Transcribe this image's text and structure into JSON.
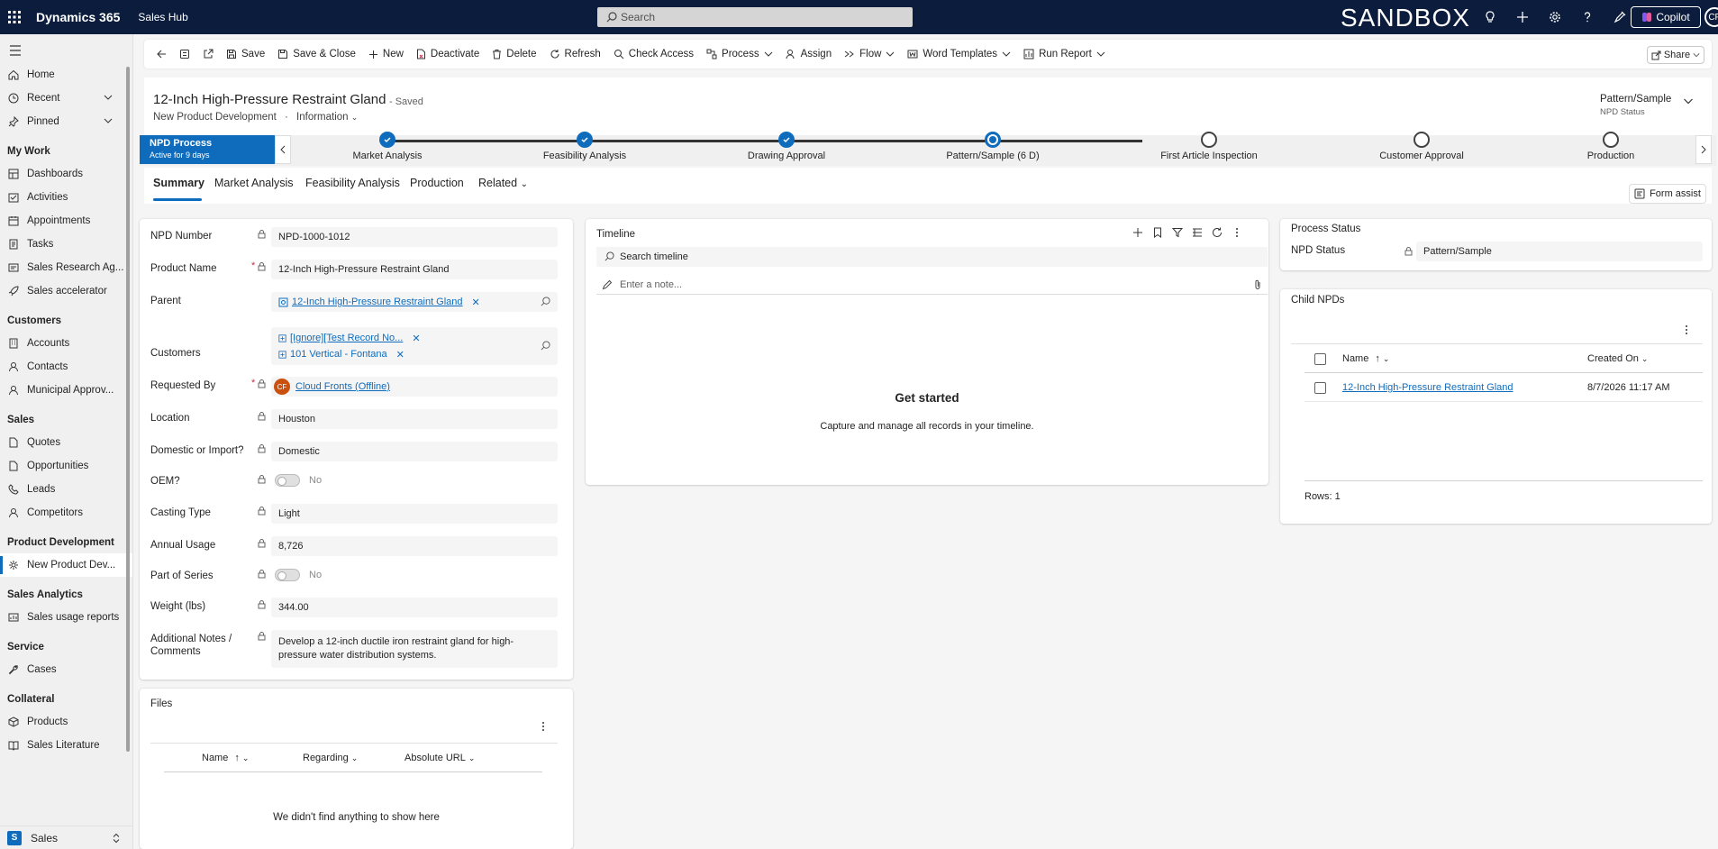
{
  "topbar": {
    "brand": "Dynamics 365",
    "app_name": "Sales Hub",
    "search_placeholder": "Search",
    "environment": "SANDBOX",
    "copilot_label": "Copilot",
    "avatar_initials": "CF"
  },
  "sidebar": {
    "top": [
      {
        "label": "Home"
      },
      {
        "label": "Recent"
      },
      {
        "label": "Pinned"
      }
    ],
    "sections": [
      {
        "title": "My Work",
        "items": [
          "Dashboards",
          "Activities",
          "Appointments",
          "Tasks",
          "Sales Research Ag...",
          "Sales accelerator"
        ]
      },
      {
        "title": "Customers",
        "items": [
          "Accounts",
          "Contacts",
          "Municipal Approv..."
        ]
      },
      {
        "title": "Sales",
        "items": [
          "Quotes",
          "Opportunities",
          "Leads",
          "Competitors"
        ]
      },
      {
        "title": "Product Development",
        "items": [
          "New Product Dev..."
        ]
      },
      {
        "title": "Sales Analytics",
        "items": [
          "Sales usage reports"
        ]
      },
      {
        "title": "Service",
        "items": [
          "Cases"
        ]
      },
      {
        "title": "Collateral",
        "items": [
          "Products",
          "Sales Literature"
        ]
      }
    ],
    "area_badge": "S",
    "area_label": "Sales"
  },
  "commands": {
    "save": "Save",
    "save_close": "Save & Close",
    "new": "New",
    "deactivate": "Deactivate",
    "delete": "Delete",
    "refresh": "Refresh",
    "check_access": "Check Access",
    "process": "Process",
    "assign": "Assign",
    "flow": "Flow",
    "word_templates": "Word Templates",
    "run_report": "Run Report",
    "share": "Share"
  },
  "record": {
    "title": "12-Inch High-Pressure Restraint Gland",
    "saved_status": "- Saved",
    "entity": "New Product Development",
    "form": "Information",
    "header_field_value": "Pattern/Sample",
    "header_field_label": "NPD Status"
  },
  "bpf": {
    "name": "NPD Process",
    "duration": "Active for 9 days",
    "stages": [
      {
        "label": "Market Analysis",
        "state": "done"
      },
      {
        "label": "Feasibility Analysis",
        "state": "done"
      },
      {
        "label": "Drawing Approval",
        "state": "done"
      },
      {
        "label": "Pattern/Sample  (6 D)",
        "state": "current"
      },
      {
        "label": "First Article Inspection",
        "state": "todo"
      },
      {
        "label": "Customer Approval",
        "state": "todo"
      },
      {
        "label": "Production",
        "state": "todo"
      }
    ]
  },
  "tabs": [
    "Summary",
    "Market Analysis",
    "Feasibility Analysis",
    "Production",
    "Related"
  ],
  "form_assist": "Form assist",
  "fields": {
    "npd_number": {
      "label": "NPD Number",
      "value": "NPD-1000-1012"
    },
    "product_name": {
      "label": "Product Name",
      "value": "12-Inch High-Pressure Restraint Gland"
    },
    "parent": {
      "label": "Parent",
      "value": "12-Inch High-Pressure Restraint Gland"
    },
    "customers": {
      "label": "Customers",
      "values": [
        "[Ignore][Test Record No...",
        "101 Vertical - Fontana"
      ]
    },
    "requested_by": {
      "label": "Requested By",
      "initials": "CF",
      "value": "Cloud Fronts (Offline)"
    },
    "location": {
      "label": "Location",
      "value": "Houston"
    },
    "domestic": {
      "label": "Domestic or Import?",
      "value": "Domestic"
    },
    "oem": {
      "label": "OEM?",
      "value": "No"
    },
    "casting_type": {
      "label": "Casting Type",
      "value": "Light"
    },
    "annual_usage": {
      "label": "Annual Usage",
      "value": "8,726"
    },
    "part_of_series": {
      "label": "Part of Series",
      "value": "No"
    },
    "weight": {
      "label": "Weight (lbs)",
      "value": "344.00"
    },
    "notes": {
      "label1": "Additional Notes /",
      "label2": "Comments",
      "value": "Develop a 12-inch ductile iron restraint gland for high-pressure water distribution systems."
    }
  },
  "files": {
    "title": "Files",
    "columns": [
      "Name",
      "Regarding",
      "Absolute URL"
    ],
    "name_sort": "↑",
    "empty": "We didn't find anything to show here"
  },
  "timeline": {
    "title": "Timeline",
    "search_placeholder": "Search timeline",
    "note_placeholder": "Enter a note...",
    "empty_title": "Get started",
    "empty_text": "Capture and manage all records in your timeline."
  },
  "process_status": {
    "title": "Process Status",
    "label": "NPD Status",
    "value": "Pattern/Sample"
  },
  "child_npds": {
    "title": "Child NPDs",
    "columns": [
      "Name",
      "Created On"
    ],
    "name_sort": "↑",
    "rows": [
      {
        "name": "12-Inch High-Pressure Restraint Gland",
        "created": "8/7/2026 11:17 AM"
      }
    ],
    "rows_count": "Rows: 1"
  },
  "colors": {
    "topbar": "#0b1c3d",
    "accent": "#0f6cbd",
    "required": "#c4314b",
    "avatar": "#ca5010"
  }
}
